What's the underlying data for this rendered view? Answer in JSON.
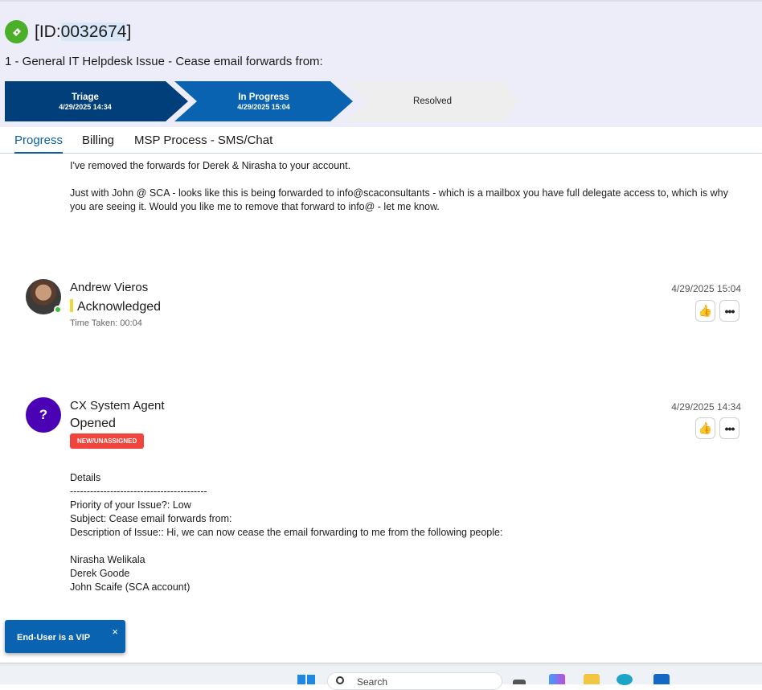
{
  "ticket": {
    "id_prefix": "[ID:",
    "id_number": "0032674",
    "id_suffix": "]",
    "title": "1 - General IT Helpdesk Issue - Cease email forwards from:"
  },
  "stages": [
    {
      "name": "Triage",
      "date": "4/29/2025 14:34"
    },
    {
      "name": "In Progress",
      "date": "4/29/2025 15:04"
    },
    {
      "name": "Resolved"
    }
  ],
  "tabs": [
    "Progress",
    "Billing",
    "MSP Process - SMS/Chat"
  ],
  "reply": {
    "line1": "I've removed the forwards for Derek & Nirasha to your account.",
    "line2": "Just with John @ SCA - looks like this is being forwarded to info@scaconsultants - which is a mailbox you have full delegate access to, which is why you are seeing it. Would you like me to remove that forward to info@ - let me know."
  },
  "entries": [
    {
      "author": "Andrew Vieros",
      "status": "Acknowledged",
      "time_taken": "Time Taken: 00:04",
      "timestamp": "4/29/2025 15:04"
    },
    {
      "author": "CX System Agent",
      "avatar_letter": "?",
      "status": "Opened",
      "badge": "NEW/UNASSIGNED",
      "timestamp": "4/29/2025 14:34",
      "details": "Details\n-----------------------------------------\nPriority of your Issue?: Low\nSubject: Cease email forwards from:\nDescription of Issue:: Hi, we can now cease the email forwarding to me from the following people:\n\nNirasha Welikala\nDerek Goode\nJohn Scaife (SCA account)"
    }
  ],
  "vip_toast": {
    "label": "End-User is a VIP",
    "close": "×"
  },
  "taskbar": {
    "search_placeholder": "Search"
  },
  "colors": {
    "accent": "#0a63b0",
    "dark_stage": "#003f7a",
    "badge_red": "#f0443c",
    "cx_avatar": "#4b02b5",
    "ticket_green": "#4caf2a"
  }
}
